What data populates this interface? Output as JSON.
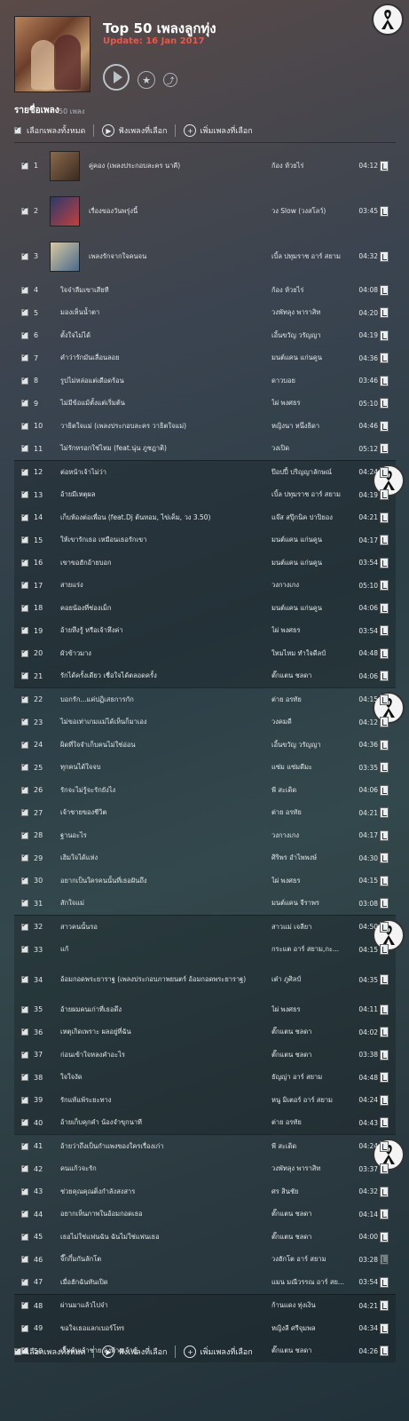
{
  "header": {
    "title": "Top 50 เพลงลูกทุ่ง",
    "update": "Update: 16 Jan 2017"
  },
  "list": {
    "title": "รายชื่อเพลง",
    "count": "50 เพลง"
  },
  "toolbar": {
    "select_all": "เลือกเพลงทั้งหมด",
    "listen_selected": "ฟังเพลงที่เลือก",
    "add_selected": "เพิ่มเพลงที่เลือก"
  },
  "tracks": [
    {
      "num": "1",
      "title": "คู่คอง (เพลงประกอบละคร นาคี)",
      "artist": "ก้อง ห้วยไร่",
      "duration": "04:12"
    },
    {
      "num": "2",
      "title": "เรื่องของวันพรุ่งนี้",
      "artist": "วง Slow (วงสโลว์)",
      "duration": "03:45"
    },
    {
      "num": "3",
      "title": "เพลงรักจากใจคนจน",
      "artist": "เบิ้ล ปทุมราช อาร์ สยาม",
      "duration": "04:32"
    },
    {
      "num": "4",
      "title": "ใจจ๋าลืมเขาเสียที",
      "artist": "ก้อง ห้วยไร่",
      "duration": "04:08"
    },
    {
      "num": "5",
      "title": "มองเห็นน้ำตา",
      "artist": "วงพัทลุง พาราสิท",
      "duration": "04:20"
    },
    {
      "num": "6",
      "title": "ตั้งใจไม่ได้",
      "artist": "เอิ้นขวัญ วรัญญา",
      "duration": "04:19"
    },
    {
      "num": "7",
      "title": "คำว่ารักมันเลื่อนลอย",
      "artist": "มนต์แคน แก่นคูน",
      "duration": "04:36"
    },
    {
      "num": "8",
      "title": "รูปไม่หล่อแต่เดือดร้อน",
      "artist": "ดาวบอย",
      "duration": "03:46"
    },
    {
      "num": "9",
      "title": "ไม่มีข้อแม้ตั้งแต่เริ่มต้น",
      "artist": "ไผ่ พงศธร",
      "duration": "05:10"
    },
    {
      "num": "10",
      "title": "วาธิตใจแม่ (เพลงประกอบละคร วาธิตใจแม่)",
      "artist": "หญิงนา หนึ่งธิดา",
      "duration": "04:46"
    },
    {
      "num": "11",
      "title": "ไม่รักหรอกใช่ไหม (feat.นุ่น ภูชฎาติ)",
      "artist": "วงเปิด",
      "duration": "05:12"
    },
    {
      "num": "12",
      "title": "ต่อหน้าเจ้าไม่ว่า",
      "artist": "ป๊อปปี้ ปริญญาลักษณ์",
      "duration": "04:24"
    },
    {
      "num": "13",
      "title": "อ้ายมีเหตุผล",
      "artist": "เบิ้ล ปทุมราช อาร์ สยาม",
      "duration": "04:19"
    },
    {
      "num": "14",
      "title": "เก็บห้องต่อเพื่อน (feat.Dj ต้นหอม, ไข่เค็ม, วง 3.50)",
      "artist": "แจ๊ส สปุ๊กนิค ปาปิยอง",
      "duration": "04:21"
    },
    {
      "num": "15",
      "title": "ให้เขารักเธอ เหมือนเธอรักเขา",
      "artist": "มนต์แคน แก่นคูน",
      "duration": "04:17"
    },
    {
      "num": "16",
      "title": "เขาขอฮักอ้ายบอก",
      "artist": "มนต์แคน แก่นคูน",
      "duration": "03:54"
    },
    {
      "num": "17",
      "title": "สายแร่ง",
      "artist": "วงกางเกง",
      "duration": "05:10"
    },
    {
      "num": "18",
      "title": "คอยน้องที่ช่องเม็ก",
      "artist": "มนต์แคน แก่นคูน",
      "duration": "04:06"
    },
    {
      "num": "19",
      "title": "อ้ายหึงรู้ หรือเจ้าหึงค่า",
      "artist": "ไผ่ พงศธร",
      "duration": "03:54"
    },
    {
      "num": "20",
      "title": "ผัวข้าวมาง",
      "artist": "ใหมไหม ทำใจดีลป์",
      "duration": "04:48"
    },
    {
      "num": "21",
      "title": "รักได้ครั้งเดียว เชื่อใจได้ตลอดครั้ง",
      "artist": "ตั๊กแตน ชลดา",
      "duration": "04:06"
    },
    {
      "num": "22",
      "title": "บอกรัก...แค่ปฏิเสธการกัก",
      "artist": "ต่าย อรทัย",
      "duration": "04:15"
    },
    {
      "num": "23",
      "title": "ไม่ขอเท่าเกมแม่ได้เห็นก็มาเอง",
      "artist": "วงคมดี",
      "duration": "04:12"
    },
    {
      "num": "24",
      "title": "ผิดที่ใจจำเก็บคนไม่ใช่อ่อน",
      "artist": "เอิ้นขวัญ วรัญญา",
      "duration": "04:36"
    },
    {
      "num": "25",
      "title": "ทุกคนได้ใจจบ",
      "artist": "แซ่ม แซ่มดีมะ",
      "duration": "03:35"
    },
    {
      "num": "26",
      "title": "รักจะไม่รู้จะรักยังไง",
      "artist": "พี สะเดิด",
      "duration": "04:06"
    },
    {
      "num": "27",
      "title": "เจ้าชายของชีวิต",
      "artist": "ต่าย อรทัย",
      "duration": "04:21"
    },
    {
      "num": "28",
      "title": "ฐานอะไร",
      "artist": "วงกางเกง",
      "duration": "04:17"
    },
    {
      "num": "29",
      "title": "เฮิมใจได้แห่ง",
      "artist": "ศิริพร อำไพพงษ์",
      "duration": "04:30"
    },
    {
      "num": "30",
      "title": "อยากเป็นใครคนนั้นที่เธอฝันถึง",
      "artist": "ไผ่ พงศธร",
      "duration": "04:15"
    },
    {
      "num": "31",
      "title": "สักใจแม่",
      "artist": "มนต์แคน จีราพร",
      "duration": "03:08"
    },
    {
      "num": "32",
      "title": "สาวคนนั้นรอ",
      "artist": "สาวแม่ เจลียา",
      "duration": "04:50"
    },
    {
      "num": "33",
      "title": "แก้",
      "artist": "กระแต อาร์ สยาม,กะ...",
      "duration": "04:15"
    },
    {
      "num": "34",
      "title": "อ้อมกอดพระยาราฐ (เพลงประกอบภาพยนตร์ อ้อมกอดพระยาราฐ)",
      "artist": "เต๋า ภูศิลป์",
      "duration": "04:35"
    },
    {
      "num": "35",
      "title": "อ้ายผมคนเก่าที่เธอดึง",
      "artist": "ไผ่ พงศธร",
      "duration": "04:11"
    },
    {
      "num": "36",
      "title": "เหตุเกิดเพราะ ผลอยู่ที่ฉัน",
      "artist": "ตั๊กแตน ชลดา",
      "duration": "04:02"
    },
    {
      "num": "37",
      "title": "ก่อนเข้าใจหลงคำอะไร",
      "artist": "ตั๊กแตน ชลดา",
      "duration": "03:38"
    },
    {
      "num": "38",
      "title": "ใจใจงัด",
      "artist": "ธัญญ่า อาร์ สยาม",
      "duration": "04:48"
    },
    {
      "num": "39",
      "title": "รักแท้แพ้ระยะทาง",
      "artist": "หนู มิเตอร์ อาร์ สยาม",
      "duration": "04:24"
    },
    {
      "num": "40",
      "title": "อ้ายเก็บคุกคำ น้องจำขุกนาที",
      "artist": "ต่าย อรทัย",
      "duration": "04:43"
    },
    {
      "num": "41",
      "title": "อ้ายว่าถึงเป็นกำแพงของใครเรื่องเก่า",
      "artist": "พี สะเดิด",
      "duration": "04:24"
    },
    {
      "num": "42",
      "title": "คนแก้วจะรัก",
      "artist": "วงพัทลุง พาราสิท",
      "duration": "03:37"
    },
    {
      "num": "43",
      "title": "ช่วยคุณคุณติ่งกำลังสงสาร",
      "artist": "ศร สินชัย",
      "duration": "04:32"
    },
    {
      "num": "44",
      "title": "อยากเห็นภาพในอ้อมกอดเธอ",
      "artist": "ตั๊กแตน ชลดา",
      "duration": "04:14"
    },
    {
      "num": "45",
      "title": "เธอไม่ใช่แฟนฉัน ฉันไม่ใช่แฟนเธอ",
      "artist": "ตั๊กแตน ชลดา",
      "duration": "04:00"
    },
    {
      "num": "46",
      "title": "จึ๊กกึ๋มกันลักโต",
      "artist": "วงฮักโต อาร์ สยาม",
      "duration": "03:28"
    },
    {
      "num": "47",
      "title": "เมื่อฮักฉันทันเปิด",
      "artist": "แมน มณีวรรณ อาร์ สย...",
      "duration": "03:54"
    },
    {
      "num": "48",
      "title": "ผ่านมาแล้วไปจ๋า",
      "artist": "ก้านแดง ทุ่งเงิน",
      "duration": "04:21"
    },
    {
      "num": "49",
      "title": "ขอใจเธอแลกเบอร์โทร",
      "artist": "หญิงลี ศรีจุมพล",
      "duration": "04:34"
    },
    {
      "num": "50",
      "title": "เริ่มต้นเจ้าชาย ลงท้ายเจ้าชู้",
      "artist": "ตั๊กแตน ชลดา",
      "duration": "04:26"
    }
  ]
}
